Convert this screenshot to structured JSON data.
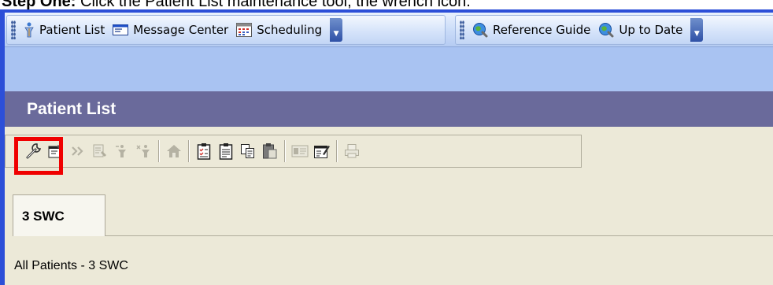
{
  "caption": {
    "step": "Step One:",
    "text": " Click the Patient List maintenance tool, the wrench icon."
  },
  "toolbar": {
    "group1": [
      {
        "label": "Patient List",
        "icon": "person-icon"
      },
      {
        "label": "Message Center",
        "icon": "message-icon"
      },
      {
        "label": "Scheduling",
        "icon": "calendar-icon"
      }
    ],
    "group2": [
      {
        "label": "Reference Guide",
        "icon": "globe-search-icon"
      },
      {
        "label": "Up to Date",
        "icon": "globe-search-icon"
      }
    ]
  },
  "patient_list": {
    "title": "Patient List",
    "tools": [
      "wrench-icon",
      "properties-icon",
      "forward-icon",
      "list-edit-icon",
      "move-icon",
      "remove-icon",
      "house-icon",
      "checklist-icon",
      "clipboard-icon",
      "copy-icon",
      "paste-icon",
      "card-icon",
      "edit-form-icon",
      "print-icon"
    ],
    "tab_label": "3 SWC",
    "list_label": "All Patients - 3 SWC"
  },
  "colors": {
    "frame": "#2c4fd8",
    "header": "#6a6a9b",
    "content": "#ece9d8",
    "highlight": "#f00000"
  }
}
